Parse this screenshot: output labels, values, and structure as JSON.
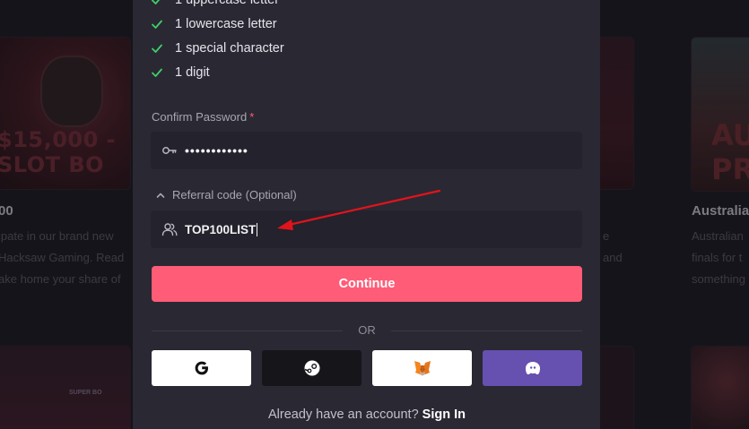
{
  "background": {
    "promos": [
      {
        "banner_text": "$15,000 -\nSLOT BO",
        "title": "00",
        "desc_lines": [
          "ipate in our brand new",
          "Hacksaw Gaming. Read",
          "ake home your share of"
        ]
      },
      {
        "banner_text": "",
        "title": "",
        "desc_lines": [
          "e",
          "and"
        ]
      },
      {
        "banner_text": "AU\nPR",
        "title": "Australia",
        "desc_lines": [
          "Australian",
          "finals for t",
          "something"
        ]
      }
    ],
    "bottom_banner_text": "SUPER BO"
  },
  "password_requirements": [
    {
      "label": "1 uppercase letter",
      "met": true
    },
    {
      "label": "1 lowercase letter",
      "met": true
    },
    {
      "label": "1 special character",
      "met": true
    },
    {
      "label": "1 digit",
      "met": true
    }
  ],
  "confirm_password": {
    "label": "Confirm Password",
    "required_marker": "*",
    "masked_value": "••••••••••••",
    "icon": "key-icon"
  },
  "referral": {
    "toggle_label": "Referral code (Optional)",
    "expanded": true,
    "value": "TOP100LIST",
    "icon": "users-icon"
  },
  "continue_label": "Continue",
  "divider_text": "OR",
  "social_logins": [
    {
      "provider": "Google",
      "icon": "google-icon"
    },
    {
      "provider": "Steam",
      "icon": "steam-icon"
    },
    {
      "provider": "MetaMask",
      "icon": "metamask-icon"
    },
    {
      "provider": "Ghost",
      "icon": "ghost-icon"
    }
  ],
  "signin": {
    "prompt": "Already have an account?",
    "link": "Sign In"
  },
  "colors": {
    "accent": "#ff5c77",
    "check": "#3fcf6a",
    "modal_bg": "#2a2833",
    "input_bg": "#24222c",
    "page_bg": "#1b1921",
    "purple_button": "#6650b0",
    "annotation_arrow": "#e0141b"
  }
}
